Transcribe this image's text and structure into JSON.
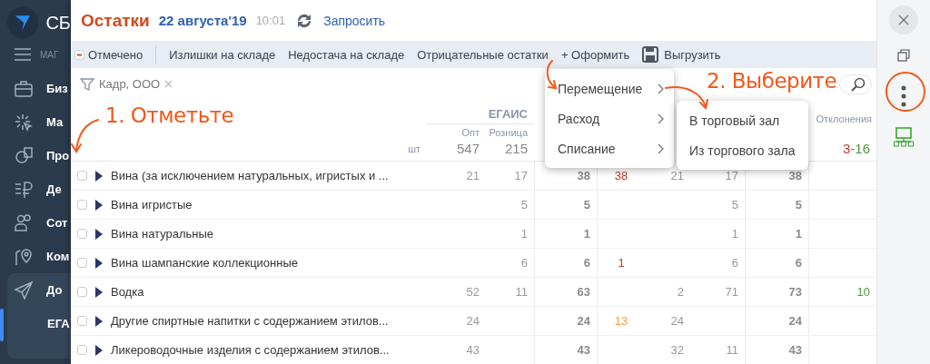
{
  "sidebar": {
    "brand": "СБ",
    "section": "МАГ",
    "items": [
      {
        "label": "Биз",
        "selected": false
      },
      {
        "label": "Ма",
        "selected": false
      },
      {
        "label": "Про",
        "selected": false
      },
      {
        "label": "Де",
        "selected": false
      },
      {
        "label": "Сот",
        "selected": false
      },
      {
        "label": "Ком",
        "selected": false
      },
      {
        "label": "До",
        "selected": true,
        "children": [
          {
            "label": "ЕГА",
            "selected": true
          }
        ]
      }
    ]
  },
  "header": {
    "title": "Остатки",
    "date": "22 августа'19",
    "time": "10:01",
    "refresh": "Запросить"
  },
  "toolbar": {
    "items": [
      {
        "kind": "mark",
        "label": "Отмечено",
        "indeterminate": true
      },
      {
        "kind": "filter",
        "label": "Излишки на складе"
      },
      {
        "kind": "filter",
        "label": "Недостача на складе"
      },
      {
        "kind": "filter",
        "label": "Отрицательные остатки"
      },
      {
        "kind": "action",
        "label": "+ Оформить"
      },
      {
        "kind": "export",
        "label": "Выгрузить"
      }
    ]
  },
  "filter": {
    "chips": [
      {
        "label": "Кадр, ООО"
      }
    ]
  },
  "table": {
    "group_header": "ЕГАИС",
    "deviation_header": "Отклонения",
    "unit": "шт",
    "columns": [
      {
        "label": "Опт",
        "total": "547"
      },
      {
        "label": "Розница",
        "total": "215"
      }
    ],
    "deviation_total": [
      {
        "text": "3",
        "color": "#c0392b"
      },
      {
        "text": "-16",
        "color": "#4a9a3a"
      }
    ],
    "rows": [
      {
        "name": "Вина (за исключением натуральных, игристых и ...",
        "checked": false,
        "expanded": false,
        "cells": [
          "21",
          "17",
          "38",
          {
            "text": "38",
            "color": "#c0392b"
          },
          "21",
          "17",
          "38",
          null
        ]
      },
      {
        "name": "Вина игристые",
        "checked": false,
        "expanded": false,
        "cells": [
          null,
          "5",
          "5",
          null,
          null,
          "5",
          "5",
          null
        ]
      },
      {
        "name": "Вина натуральные",
        "checked": false,
        "expanded": false,
        "cells": [
          null,
          "1",
          "1",
          null,
          null,
          "1",
          "1",
          null
        ]
      },
      {
        "name": "Вина шампанские коллекционные",
        "checked": false,
        "expanded": false,
        "cells": [
          null,
          "6",
          "6",
          {
            "text": "1",
            "color": "#c0392b"
          },
          null,
          "6",
          "6",
          null
        ]
      },
      {
        "name": "Водка",
        "checked": false,
        "expanded": false,
        "cells": [
          "52",
          "11",
          "63",
          null,
          "2",
          "71",
          "73",
          {
            "text": "10",
            "color": "#4a9a3a"
          }
        ]
      },
      {
        "name": "Другие спиртные напитки с содержанием этилов...",
        "checked": false,
        "expanded": false,
        "cells": [
          "24",
          null,
          "24",
          {
            "text": "13",
            "color": "#f0a040"
          },
          "24",
          null,
          "24",
          null
        ]
      },
      {
        "name": "Ликероводочные изделия с содержанием этилов...",
        "checked": false,
        "expanded": false,
        "cells": [
          "43",
          null,
          "43",
          null,
          "32",
          "11",
          "43",
          null
        ]
      }
    ]
  },
  "menu": {
    "items": [
      {
        "label": "Перемещение"
      },
      {
        "label": "Расход"
      },
      {
        "label": "Списание"
      }
    ],
    "submenu": {
      "items": [
        {
          "label": "В торговый зал"
        },
        {
          "label": "Из торгового зала"
        }
      ]
    }
  },
  "annotations": [
    {
      "text": "1. Отметьте"
    },
    {
      "text": "2. Выберите"
    }
  ]
}
